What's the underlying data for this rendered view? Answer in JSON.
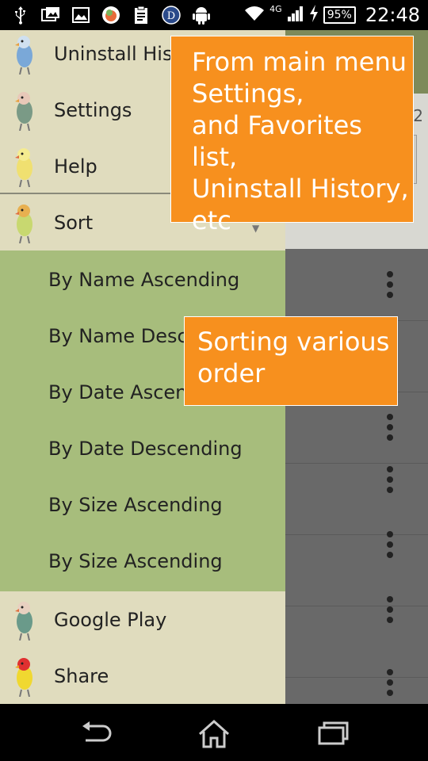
{
  "status_bar": {
    "time": "22:48",
    "battery": "95%",
    "network": "4G",
    "icons": [
      "usb-icon",
      "picture-icon",
      "gallery-icon",
      "bird-app-icon",
      "clipboard-icon",
      "d-app-icon",
      "android-icon",
      "wifi-icon",
      "signal-icon",
      "charging-icon"
    ]
  },
  "background_app": {
    "count": "2"
  },
  "drawer": {
    "items": [
      {
        "label": "Uninstall History",
        "icon": "lovebird-blue-icon"
      },
      {
        "label": "Settings",
        "icon": "lovebird-green-icon"
      },
      {
        "label": "Help",
        "icon": "lovebird-yellow-icon"
      },
      {
        "label": "Sort",
        "icon": "lovebird-lime-icon"
      }
    ],
    "sort_options": [
      "By Name Ascending",
      "By Name Descending",
      "By Date Ascending",
      "By Date Descending",
      "By Size Ascending",
      "By Size Ascending"
    ],
    "footer_items": [
      {
        "label": "Google Play",
        "icon": "lovebird-teal-icon"
      },
      {
        "label": "Share",
        "icon": "lovebird-red-icon"
      }
    ]
  },
  "callouts": {
    "top": [
      "From main menu",
      "Settings,",
      "and Favorites list,",
      "Uninstall History,",
      "etc"
    ],
    "middle": [
      "Sorting various",
      "order"
    ]
  },
  "navbar": {
    "icons": [
      "back-icon",
      "home-icon",
      "recent-apps-icon"
    ]
  },
  "colors": {
    "drawer_bg": "#e0dcbe",
    "sort_bg": "#a7bd7c",
    "callout": "#f7901e"
  }
}
